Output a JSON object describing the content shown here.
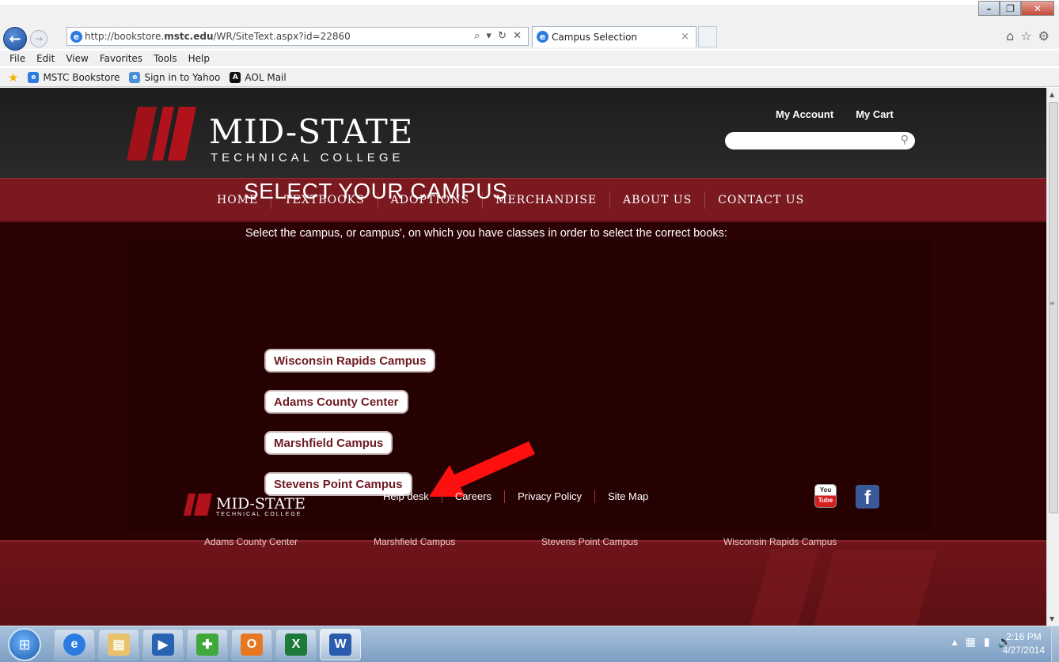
{
  "window": {
    "controls": [
      "–",
      "❐",
      "✕"
    ]
  },
  "browser": {
    "address": {
      "prefix": "http://bookstore.",
      "domain": "mstc.edu",
      "path": "/WR/SiteText.aspx?id=22860",
      "tools": "⌕ ▾ ↻ ✕"
    },
    "tab_title": "Campus Selection",
    "tab_close": "×",
    "right_icons": [
      "⌂",
      "☆",
      "⚙"
    ]
  },
  "menubar": [
    "File",
    "Edit",
    "View",
    "Favorites",
    "Tools",
    "Help"
  ],
  "favorites": [
    "MSTC Bookstore",
    "Sign in to Yahoo",
    "AOL Mail"
  ],
  "header": {
    "logo_big": "MID-STATE",
    "logo_small": "TECHNICAL COLLEGE",
    "my_account": "My Account",
    "my_cart": "My Cart",
    "search_value": ""
  },
  "nav": [
    "HOME",
    "TEXTBOOKS",
    "ADOPTIONS",
    "MERCHANDISE",
    "ABOUT US",
    "CONTACT US"
  ],
  "content": {
    "title": "SELECT YOUR CAMPUS",
    "description": "Select the campus, or campus', on which you have classes in order to select the correct books:",
    "campuses": [
      "Wisconsin Rapids Campus",
      "Adams County Center",
      "Marshfield Campus",
      "Stevens Point Campus"
    ]
  },
  "footer": {
    "logo_big": "MID-STATE",
    "logo_small": "TECHNICAL COLLEGE",
    "links": [
      "Help desk",
      "Careers",
      "Privacy Policy",
      "Site Map"
    ],
    "youtube_top": "You",
    "youtube_bottom": "Tube",
    "facebook": "f",
    "bottom_row": [
      "Adams County Center",
      "Marshfield Campus",
      "Stevens Point Campus",
      "Wisconsin Rapids Campus"
    ]
  },
  "taskbar": {
    "apps": [
      "ie",
      "explorer",
      "media",
      "puzzle",
      "outlook",
      "excel",
      "word"
    ],
    "clock_time": "2:16 PM",
    "clock_date": "4/27/2014"
  },
  "colors": {
    "brand_red": "#7a1a20",
    "page_dark": "#2a0203",
    "campus_text": "#6e1b22",
    "arrow": "#ff1010"
  }
}
